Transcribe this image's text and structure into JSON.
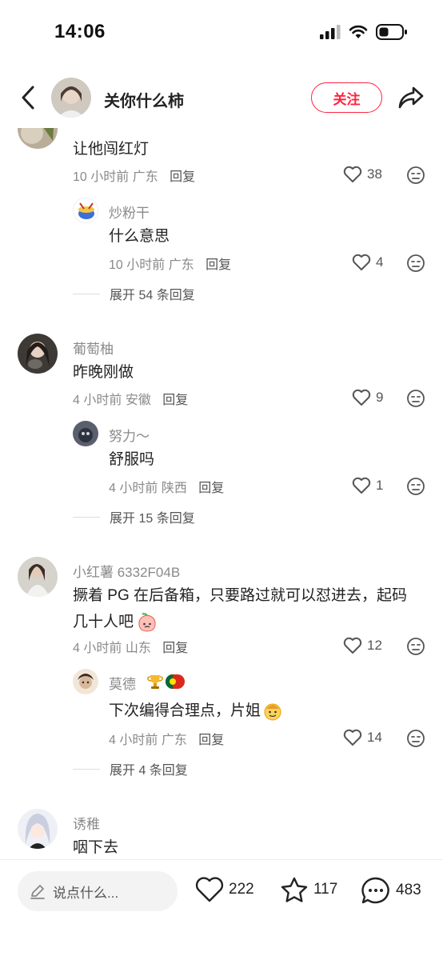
{
  "status": {
    "time": "14:06"
  },
  "header": {
    "title": "关你什么柿",
    "follow_label": "关注"
  },
  "comments": [
    {
      "text": "让他闯红灯",
      "time": "10 小时前",
      "location": "广东",
      "reply_label": "回复",
      "likes": "38"
    },
    {
      "name": "炒粉干",
      "text": "什么意思",
      "time": "10 小时前",
      "location": "广东",
      "reply_label": "回复",
      "likes": "4",
      "expand": "展开 54 条回复"
    },
    {
      "name": "葡萄柚",
      "text": "昨晚刚做",
      "time": "4 小时前",
      "location": "安徽",
      "reply_label": "回复",
      "likes": "9"
    },
    {
      "name": "努力～",
      "text": "舒服吗",
      "time": "4 小时前",
      "location": "陕西",
      "reply_label": "回复",
      "likes": "1",
      "expand": "展开 15 条回复"
    },
    {
      "name": "小红薯 6332F04B",
      "text_line1": "撅着 PG 在后备箱，只要路过就可以怼进去，起码",
      "text_line2": "几十人吧",
      "time": "4 小时前",
      "location": "山东",
      "reply_label": "回复",
      "likes": "12"
    },
    {
      "name": "莫德",
      "text": "下次编得合理点，片姐",
      "time": "4 小时前",
      "location": "广东",
      "reply_label": "回复",
      "likes": "14",
      "expand": "展开 4 条回复"
    },
    {
      "name": "诱稚",
      "text": "咽下去"
    }
  ],
  "bottom": {
    "placeholder": "说点什么...",
    "likes": "222",
    "collects": "117",
    "comments": "483"
  },
  "colors": {
    "accent": "#ff2442",
    "muted": "#8a8a8a"
  }
}
